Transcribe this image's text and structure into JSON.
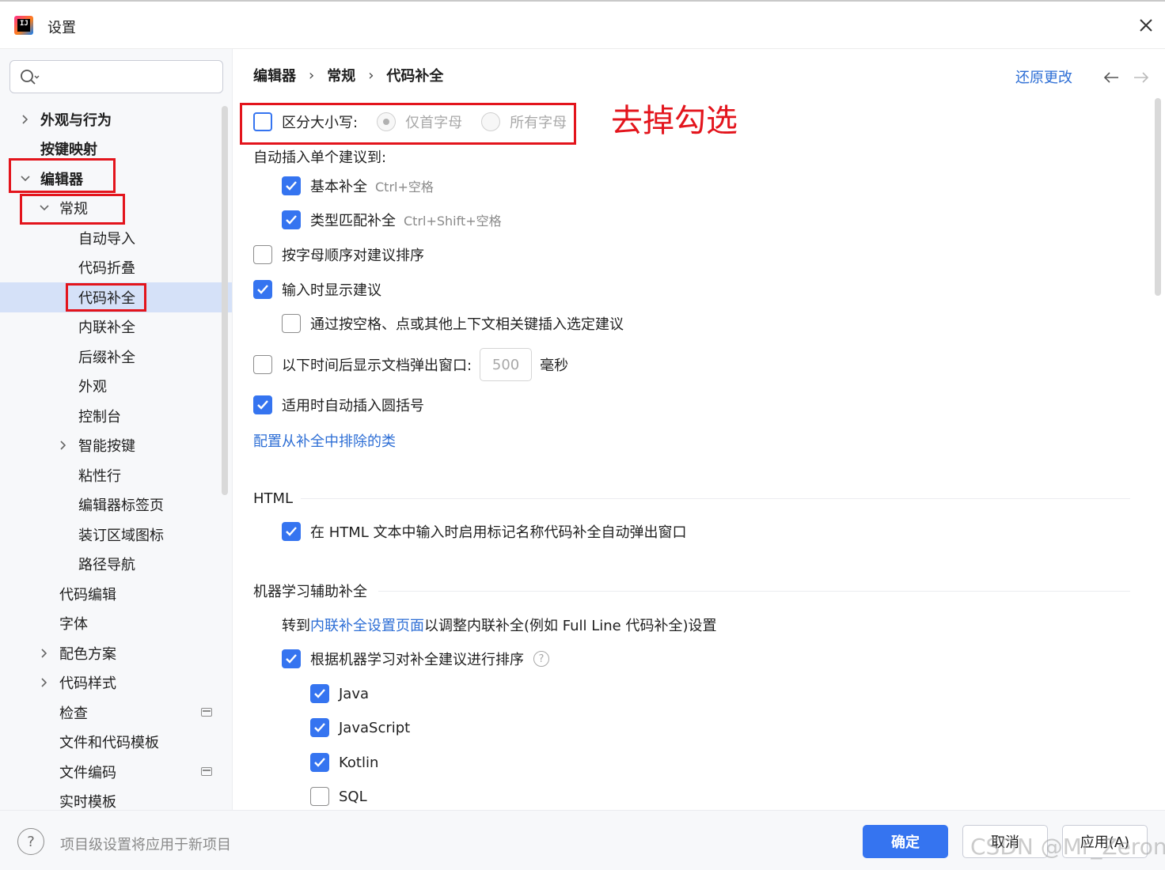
{
  "window": {
    "title": "设置",
    "app_icon_text": "IJ"
  },
  "sidebar": {
    "search_placeholder": "",
    "items": [
      {
        "label": "外观与行为"
      },
      {
        "label": "按键映射"
      },
      {
        "label": "编辑器"
      },
      {
        "label": "常规"
      },
      {
        "label": "自动导入"
      },
      {
        "label": "代码折叠"
      },
      {
        "label": "代码补全"
      },
      {
        "label": "内联补全"
      },
      {
        "label": "后缀补全"
      },
      {
        "label": "外观"
      },
      {
        "label": "控制台"
      },
      {
        "label": "智能按键"
      },
      {
        "label": "粘性行"
      },
      {
        "label": "编辑器标签页"
      },
      {
        "label": "装订区域图标"
      },
      {
        "label": "路径导航"
      },
      {
        "label": "代码编辑"
      },
      {
        "label": "字体"
      },
      {
        "label": "配色方案"
      },
      {
        "label": "代码样式"
      },
      {
        "label": "检查"
      },
      {
        "label": "文件和代码模板"
      },
      {
        "label": "文件编码"
      },
      {
        "label": "实时模板"
      }
    ]
  },
  "header": {
    "breadcrumb": [
      "编辑器",
      "常规",
      "代码补全"
    ],
    "reset_label": "还原更改"
  },
  "settings": {
    "case_sensitive": {
      "label": "区分大小写:",
      "checked": false,
      "radio_first": "仅首字母",
      "radio_all": "所有字母"
    },
    "auto_insert_title": "自动插入单个建议到:",
    "basic_completion": {
      "label": "基本补全",
      "shortcut": "Ctrl+空格",
      "checked": true
    },
    "type_match_completion": {
      "label": "类型匹配补全",
      "shortcut": "Ctrl+Shift+空格",
      "checked": true
    },
    "sort_alpha": {
      "label": "按字母顺序对建议排序",
      "checked": false
    },
    "show_on_typing": {
      "label": "输入时显示建议",
      "checked": true
    },
    "insert_by_space": {
      "label": "通过按空格、点或其他上下文相关键插入选定建议",
      "checked": false
    },
    "doc_popup": {
      "label": "以下时间后显示文档弹出窗口:",
      "value": "500",
      "unit": "毫秒",
      "checked": false
    },
    "auto_parens": {
      "label": "适用时自动插入圆括号",
      "checked": true
    },
    "exclude_link": "配置从补全中排除的类",
    "html_section": "HTML",
    "html_popup": {
      "label": "在 HTML 文本中输入时启用标记名称代码补全自动弹出窗口",
      "checked": true
    },
    "ml_section": "机器学习辅助补全",
    "ml_goto_prefix": "转到",
    "ml_goto_link": "内联补全设置页面",
    "ml_goto_suffix": "以调整内联补全(例如 Full Line 代码补全)设置",
    "ml_sort": {
      "label": "根据机器学习对补全建议进行排序",
      "checked": true
    },
    "languages": [
      {
        "label": "Java",
        "checked": true
      },
      {
        "label": "JavaScript",
        "checked": true
      },
      {
        "label": "Kotlin",
        "checked": true
      },
      {
        "label": "SQL",
        "checked": false
      }
    ]
  },
  "annotation": "去掉勾选",
  "footer": {
    "note": "项目级设置将应用于新项目",
    "ok": "确定",
    "cancel": "取消",
    "apply": "应用(A)",
    "watermark": "CSDN @Mr_Zerone"
  },
  "colors": {
    "accent": "#3574f0",
    "link": "#2d6ed5",
    "highlight_box": "#e3141c",
    "selected_bg": "#d5e1f8"
  }
}
